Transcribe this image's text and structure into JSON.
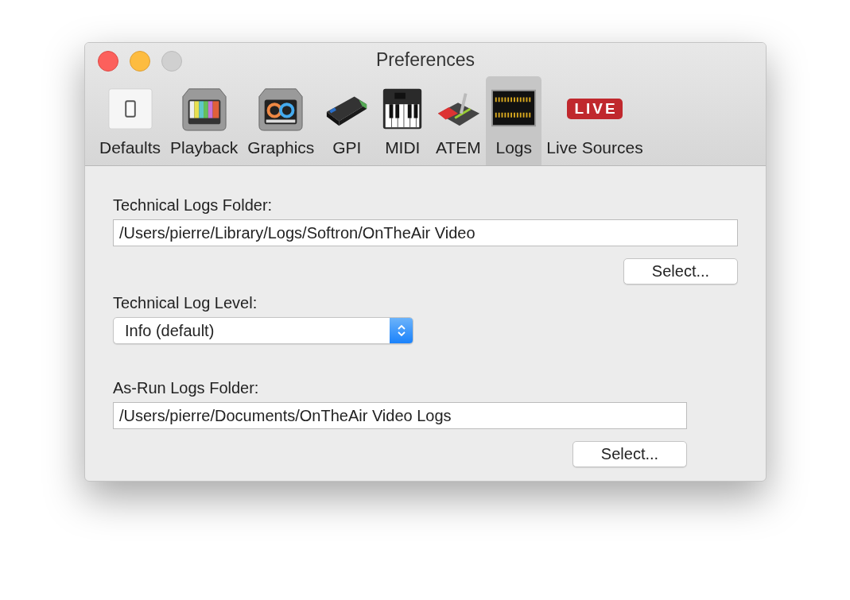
{
  "window": {
    "title": "Preferences"
  },
  "tabs": [
    {
      "label": "Defaults",
      "kind": "switch",
      "selected": false
    },
    {
      "label": "Playback",
      "kind": "bars",
      "selected": false
    },
    {
      "label": "Graphics",
      "kind": "cg",
      "selected": false
    },
    {
      "label": "GPI",
      "kind": "box",
      "selected": false
    },
    {
      "label": "MIDI",
      "kind": "keys",
      "selected": false
    },
    {
      "label": "ATEM",
      "kind": "lever",
      "selected": false
    },
    {
      "label": "Logs",
      "kind": "display",
      "selected": true
    },
    {
      "label": "Live Sources",
      "kind": "live",
      "icon_text": "LIVE",
      "selected": false
    }
  ],
  "technical_folder": {
    "label": "Technical Logs Folder:",
    "value": "/Users/pierre/Library/Logs/Softron/OnTheAir Video",
    "button": "Select..."
  },
  "log_level": {
    "label": "Technical Log Level:",
    "value": "Info (default)"
  },
  "asrun_folder": {
    "label": "As-Run Logs Folder:",
    "value": "/Users/pierre/Documents/OnTheAir Video Logs",
    "button": "Select..."
  }
}
